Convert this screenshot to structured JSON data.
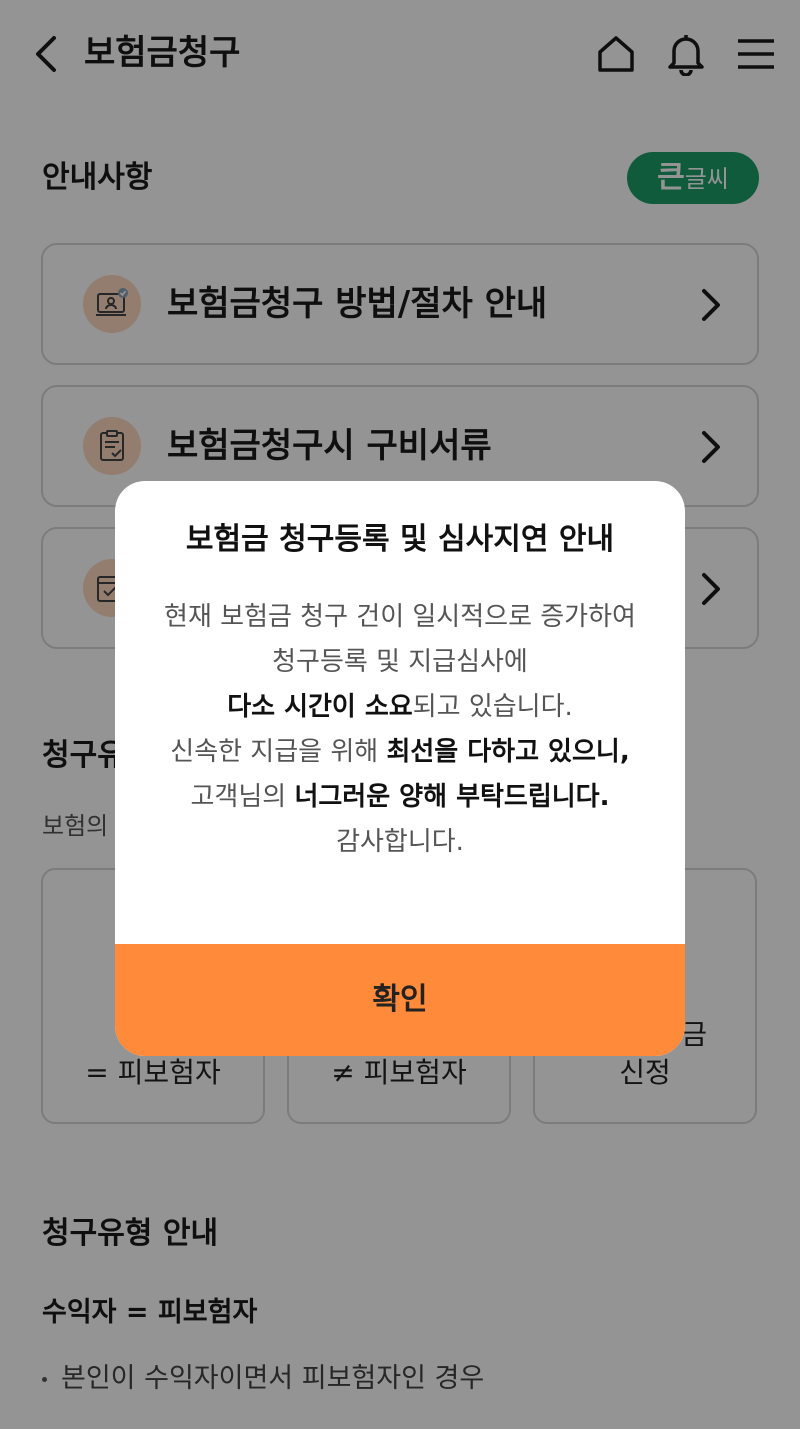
{
  "header": {
    "title": "보험금청구"
  },
  "notice": {
    "title": "안내사항",
    "big_font_label_big": "큰",
    "big_font_label_small": "글씨",
    "items": [
      {
        "label": "보험금청구 방법/절차 안내",
        "icon": "person-laptop-icon"
      },
      {
        "label": "보험금청구시 구비서류",
        "icon": "clipboard-check-icon"
      },
      {
        "label": "",
        "icon": "calendar-check-icon"
      }
    ]
  },
  "claim_type": {
    "title": "청구유",
    "desc": "보험의",
    "cards": [
      {
        "line1": "",
        "line2": "= 피보험자"
      },
      {
        "line1": "",
        "line2": "≠ 피보험자"
      },
      {
        "line1": "금",
        "line2": "신정"
      }
    ]
  },
  "guide": {
    "title": "청구유형 안내",
    "subtitle": "수익자 = 피보험자",
    "bullet": "본인이 수익자이면서 피보험자인 경우"
  },
  "modal": {
    "title": "보험금 청구등록 및 심사지연 안내",
    "line1": "현재 보험금 청구 건이 일시적으로 증가하여",
    "line2": "청구등록 및 지급심사에",
    "line3_bold": "다소 시간이 소요",
    "line3_rest": "되고 있습니다.",
    "line4_pre": "신속한 지급을 위해 ",
    "line4_bold": "최선을 다하고 있으니,",
    "line5_pre": "고객님의 ",
    "line5_bold": "너그러운 양해 부탁드립니다.",
    "line6": "감사합니다.",
    "confirm_label": "확인"
  },
  "colors": {
    "accent_orange": "#ff8a3a",
    "big_font_green": "#1e9e6a",
    "icon_bg": "#fbd8c0"
  }
}
